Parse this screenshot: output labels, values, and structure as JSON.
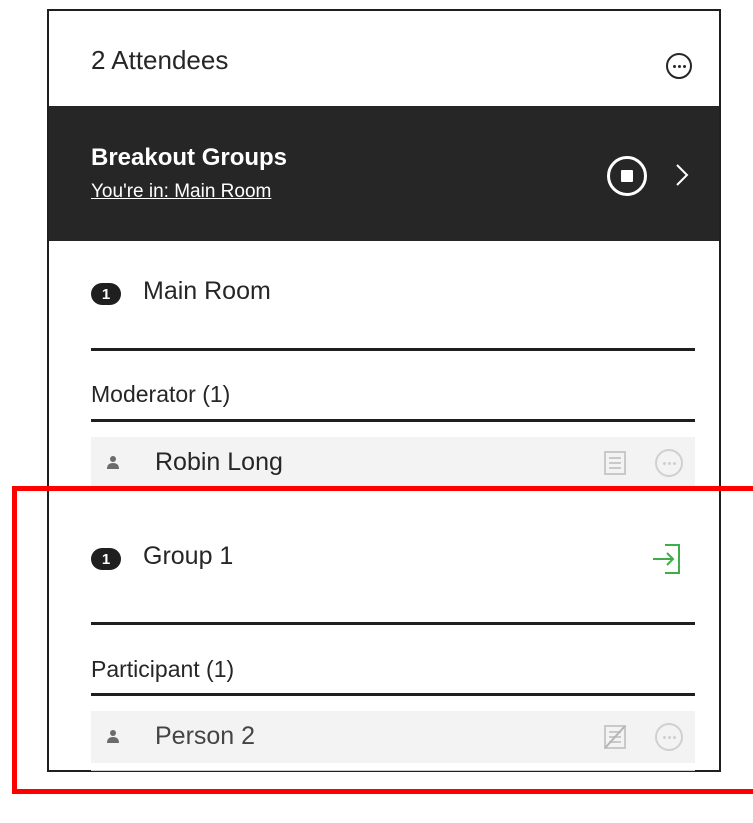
{
  "header": {
    "title": "2 Attendees"
  },
  "breakout": {
    "title": "Breakout Groups",
    "location": "You're in: Main Room"
  },
  "groups": [
    {
      "count": "1",
      "name": "Main Room",
      "role": "Moderator (1)",
      "attendee": {
        "name": "Robin Long"
      }
    },
    {
      "count": "1",
      "name": "Group 1",
      "role": "Participant (1)",
      "attendee": {
        "name": "Person 2"
      }
    }
  ],
  "colors": {
    "dark_band": "#262626",
    "join_icon": "#3fae49",
    "highlight": "#ff0000"
  }
}
